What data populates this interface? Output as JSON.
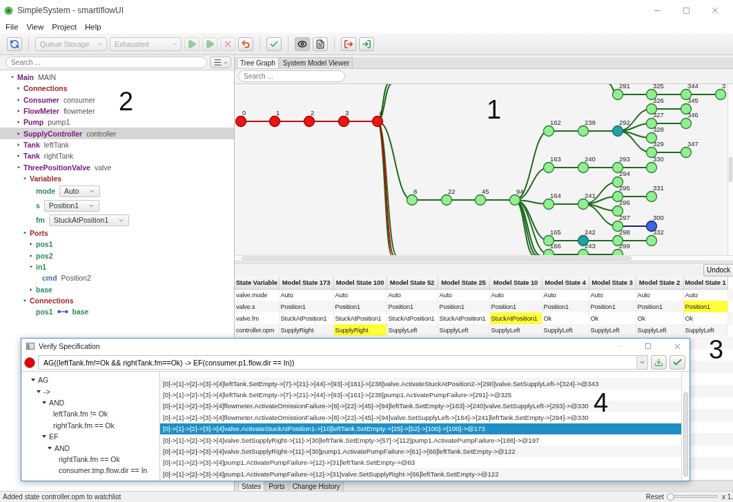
{
  "window": {
    "title": "SimpleSystem - smartIflowUI"
  },
  "menu": [
    "File",
    "View",
    "Project",
    "Help"
  ],
  "toolbar": {
    "groups": [
      [
        {
          "kind": "sync",
          "disabled": false,
          "pressed": false
        }
      ],
      [
        {
          "kind": "combo",
          "value": "Queue Storage",
          "disabled": true
        },
        {
          "kind": "combo",
          "value": "Exhausted",
          "disabled": true
        },
        {
          "kind": "play",
          "disabled": true,
          "pressed": false
        },
        {
          "kind": "fast-play",
          "disabled": true,
          "pressed": false
        },
        {
          "kind": "stop",
          "disabled": true,
          "pressed": false
        },
        {
          "kind": "undo",
          "disabled": false,
          "pressed": false
        }
      ],
      [
        {
          "kind": "verify",
          "disabled": false,
          "pressed": false
        }
      ],
      [
        {
          "kind": "eye",
          "disabled": false,
          "pressed": true
        },
        {
          "kind": "document",
          "disabled": false,
          "pressed": false
        }
      ],
      [
        {
          "kind": "exit",
          "disabled": false,
          "pressed": false
        },
        {
          "kind": "enter",
          "disabled": false,
          "pressed": false
        }
      ]
    ]
  },
  "model_tree": {
    "search": {
      "placeholder": "Search ..."
    },
    "items": [
      {
        "kind": "component",
        "type": "Main",
        "name": "MAIN",
        "expanded": true,
        "selected": false,
        "children": [
          {
            "kind": "group",
            "label": "Connections",
            "expanded": false,
            "selected": false
          },
          {
            "kind": "component",
            "type": "Consumer",
            "name": "consumer",
            "expanded": false,
            "selected": false
          },
          {
            "kind": "component",
            "type": "FlowMeter",
            "name": "flowmeter",
            "expanded": false,
            "selected": false
          },
          {
            "kind": "component",
            "type": "Pump",
            "name": "pump1",
            "expanded": false,
            "selected": false
          },
          {
            "kind": "component",
            "type": "SupplyController",
            "name": "controller",
            "expanded": false,
            "selected": true
          },
          {
            "kind": "component",
            "type": "Tank",
            "name": "leftTank",
            "expanded": false,
            "selected": false
          },
          {
            "kind": "component",
            "type": "Tank",
            "name": "rightTank",
            "expanded": false,
            "selected": false
          },
          {
            "kind": "component",
            "type": "ThreePositionValve",
            "name": "valve",
            "expanded": true,
            "selected": false,
            "children": [
              {
                "kind": "group",
                "label": "Variables",
                "expanded": true,
                "selected": false,
                "children": [
                  {
                    "kind": "variable",
                    "label": "mode",
                    "value": "Auto",
                    "selected": false
                  },
                  {
                    "kind": "variable",
                    "label": "s",
                    "value": "Position1",
                    "selected": false
                  },
                  {
                    "kind": "variable",
                    "label": "fm",
                    "value": "StuckAtPosition1",
                    "selected": false
                  }
                ]
              },
              {
                "kind": "group",
                "label": "Ports",
                "expanded": true,
                "selected": false,
                "children": [
                  {
                    "kind": "port",
                    "label": "pos1",
                    "expanded": false,
                    "selected": false
                  },
                  {
                    "kind": "port",
                    "label": "pos2",
                    "expanded": false,
                    "selected": false
                  },
                  {
                    "kind": "port",
                    "label": "in1",
                    "expanded": true,
                    "selected": false,
                    "children": [
                      {
                        "kind": "field",
                        "label": "cmd",
                        "value": "Position2",
                        "selected": false
                      }
                    ]
                  },
                  {
                    "kind": "port",
                    "label": "base",
                    "expanded": false,
                    "selected": false
                  }
                ]
              },
              {
                "kind": "group",
                "label": "Connections",
                "expanded": true,
                "selected": false,
                "children": [
                  {
                    "kind": "connection",
                    "from": "pos1",
                    "to": "base",
                    "selected": false
                  }
                ]
              }
            ]
          }
        ]
      }
    ]
  },
  "tabs": [
    {
      "label": "Tree Graph",
      "selected": true
    },
    {
      "label": "System Model Viewer",
      "selected": false
    }
  ],
  "graph": {
    "search": {
      "placeholder": "Search ..."
    },
    "trees": [
      {
        "label": "0",
        "kind": "path",
        "children": [
          {
            "label": "1",
            "kind": "path",
            "children": [
              {
                "label": "2",
                "kind": "path",
                "children": [
                  {
                    "label": "3",
                    "kind": "path",
                    "children": [
                      {
                        "label": "4",
                        "kind": "path",
                        "children": [
                          {
                            "label": "8",
                            "kind": "state",
                            "children": [
                              {
                                "label": "22",
                                "kind": "state",
                                "children": [
                                  {
                                    "label": "45",
                                    "kind": "state",
                                    "children": [
                                      {
                                        "label": "94",
                                        "kind": "state",
                                        "children": [
                                          {
                                            "label": "162",
                                            "kind": "state",
                                            "children": [
                                              {
                                                "label": "239",
                                                "kind": "state",
                                                "children": [
                                                  {
                                                    "label": "292",
                                                    "kind": "marked",
                                                    "children": [
                                                      {
                                                        "label": "326",
                                                        "kind": "state",
                                                        "children": [
                                                          {
                                                            "label": "345",
                                                            "kind": "state"
                                                          }
                                                        ]
                                                      },
                                                      {
                                                        "label": "327",
                                                        "kind": "state",
                                                        "children": [
                                                          {
                                                            "label": "346",
                                                            "kind": "state"
                                                          }
                                                        ]
                                                      },
                                                      {
                                                        "label": "328",
                                                        "kind": "state"
                                                      },
                                                      {
                                                        "label": "329",
                                                        "kind": "state",
                                                        "children": [
                                                          {
                                                            "label": "347",
                                                            "kind": "state"
                                                          }
                                                        ]
                                                      }
                                                    ]
                                                  }
                                                ]
                                              }
                                            ]
                                          },
                                          {
                                            "label": "163",
                                            "kind": "state",
                                            "children": [
                                              {
                                                "label": "240",
                                                "kind": "state",
                                                "children": [
                                                  {
                                                    "label": "293",
                                                    "kind": "state",
                                                    "children": [
                                                      {
                                                        "label": "330",
                                                        "kind": "state"
                                                      }
                                                    ]
                                                  }
                                                ]
                                              }
                                            ]
                                          },
                                          {
                                            "label": "164",
                                            "kind": "state",
                                            "children": [
                                              {
                                                "label": "241",
                                                "kind": "state",
                                                "children": [
                                                  {
                                                    "label": "294",
                                                    "kind": "state"
                                                  },
                                                  {
                                                    "label": "295",
                                                    "kind": "state",
                                                    "children": [
                                                      {
                                                        "label": "331",
                                                        "kind": "state"
                                                      }
                                                    ]
                                                  },
                                                  {
                                                    "label": "296",
                                                    "kind": "state"
                                                  },
                                                  {
                                                    "label": "297",
                                                    "kind": "state",
                                                    "children": [
                                                      {
                                                        "label": "300",
                                                        "kind": "current"
                                                      }
                                                    ]
                                                  }
                                                ]
                                              }
                                            ]
                                          },
                                          {
                                            "label": "165",
                                            "kind": "state",
                                            "children": [
                                              {
                                                "label": "242",
                                                "kind": "marked",
                                                "children": [
                                                  {
                                                    "label": "298",
                                                    "kind": "state",
                                                    "children": [
                                                      {
                                                        "label": "332",
                                                        "kind": "state"
                                                      }
                                                    ]
                                                  }
                                                ]
                                              }
                                            ]
                                          },
                                          {
                                            "label": "166",
                                            "kind": "state",
                                            "children": [
                                              {
                                                "label": "243",
                                                "kind": "state",
                                                "children": [
                                                  {
                                                    "label": "299",
                                                    "kind": "state"
                                                  }
                                                ]
                                              }
                                            ]
                                          }
                                        ]
                                      }
                                    ]
                                  }
                                ]
                              }
                            ]
                          }
                        ]
                      }
                    ]
                  }
                ]
              }
            ]
          }
        ]
      },
      {
        "label": "291",
        "kind": "state",
        "children": [
          {
            "label": "325",
            "kind": "state",
            "children": [
              {
                "label": "344",
                "kind": "state",
                "children": [
                  {
                    "label": "3",
                    "kind": "state"
                  }
                ]
              }
            ]
          }
        ]
      }
    ]
  },
  "undock_button": "Undock",
  "table": {
    "columns": [
      "State Variable",
      "Model State 173",
      "Model State 100",
      "Model State 52",
      "Model State 25",
      "Model State 10",
      "Model State 4",
      "Model State 3",
      "Model State 2",
      "Model State 1"
    ],
    "rows": [
      [
        {
          "text": "valve.mode",
          "highlighted": false
        },
        {
          "text": "Auto",
          "highlighted": false
        },
        {
          "text": "Auto",
          "highlighted": false
        },
        {
          "text": "Auto",
          "highlighted": false
        },
        {
          "text": "Auto",
          "highlighted": false
        },
        {
          "text": "Auto",
          "highlighted": false
        },
        {
          "text": "Auto",
          "highlighted": false
        },
        {
          "text": "Auto",
          "highlighted": false
        },
        {
          "text": "Auto",
          "highlighted": false
        },
        {
          "text": "Auto",
          "highlighted": false
        }
      ],
      [
        {
          "text": "valve.s",
          "highlighted": false
        },
        {
          "text": "Position1",
          "highlighted": false
        },
        {
          "text": "Position1",
          "highlighted": false
        },
        {
          "text": "Position1",
          "highlighted": false
        },
        {
          "text": "Position1",
          "highlighted": false
        },
        {
          "text": "Position1",
          "highlighted": false
        },
        {
          "text": "Position1",
          "highlighted": false
        },
        {
          "text": "Position1",
          "highlighted": false
        },
        {
          "text": "Position1",
          "highlighted": false
        },
        {
          "text": "Position1",
          "highlighted": true
        }
      ],
      [
        {
          "text": "valve.fm",
          "highlighted": false
        },
        {
          "text": "StuckAtPosition1",
          "highlighted": false
        },
        {
          "text": "StuckAtPosition1",
          "highlighted": false
        },
        {
          "text": "StuckAtPosition1",
          "highlighted": false
        },
        {
          "text": "StuckAtPosition1",
          "highlighted": false
        },
        {
          "text": "StuckAtPosition1",
          "highlighted": true
        },
        {
          "text": "Ok",
          "highlighted": false
        },
        {
          "text": "Ok",
          "highlighted": false
        },
        {
          "text": "Ok",
          "highlighted": false
        },
        {
          "text": "Ok",
          "highlighted": false
        }
      ],
      [
        {
          "text": "controller.opm",
          "highlighted": false
        },
        {
          "text": "SupplyRight",
          "highlighted": false
        },
        {
          "text": "SupplyRight",
          "highlighted": true
        },
        {
          "text": "SupplyLeft",
          "highlighted": false
        },
        {
          "text": "SupplyLeft",
          "highlighted": false
        },
        {
          "text": "SupplyLeft",
          "highlighted": false
        },
        {
          "text": "SupplyLeft",
          "highlighted": false
        },
        {
          "text": "SupplyLeft",
          "highlighted": false
        },
        {
          "text": "SupplyLeft",
          "highlighted": false
        },
        {
          "text": "SupplyLeft",
          "highlighted": false
        }
      ]
    ]
  },
  "bottom_tabs": [
    {
      "label": "States",
      "selected": true
    },
    {
      "label": "Ports",
      "selected": false
    },
    {
      "label": "Change History",
      "selected": false
    }
  ],
  "status_bar": {
    "message": "Added state controller.opm to watchlist",
    "zoom_reset": "Reset",
    "zoom": {
      "level": 0.04
    },
    "zoom_reading": "x 1."
  },
  "verify_dialog": {
    "title": "Verify Specification",
    "failed": true,
    "formula": "AG((leftTank.fm!=Ok && rightTank.fm==Ok) -> EF(consumer.p1.flow.dir == In))",
    "formula_tree": [
      {
        "label": "AG",
        "expanded": true,
        "children": [
          {
            "label": "->",
            "expanded": true,
            "children": [
              {
                "label": "AND",
                "expanded": true,
                "children": [
                  {
                    "label": "leftTank.fm != Ok"
                  },
                  {
                    "label": "rightTank.fm == Ok"
                  }
                ]
              },
              {
                "label": "EF",
                "expanded": true,
                "children": [
                  {
                    "label": "AND",
                    "expanded": true,
                    "children": [
                      {
                        "label": "rightTank.fm == Ok"
                      },
                      {
                        "label": "consumer.tmp.flow.dir == In"
                      }
                    ]
                  }
                ]
              }
            ]
          }
        ]
      }
    ],
    "traces": [
      {
        "text": "[0]->[1]->[2]->[3]->[4]leftTank.SetEmpty->[7]->[21]->[44]->[93]->[161]->[238]valve.ActivateStuckAtPosition2->[290]valve.SetSupplyLeft->[324]->@343",
        "selected": false
      },
      {
        "text": "[0]->[1]->[2]->[3]->[4]leftTank.SetEmpty->[7]->[21]->[44]->[93]->[161]->[238]pump1.ActivatePumpFailure->[291]->@325",
        "selected": false
      },
      {
        "text": "[0]->[1]->[2]->[3]->[4]flowmeter.ActivateOmissionFailure->[8]->[22]->[45]->[94]leftTank.SetEmpty->[163]->[240]valve.SetSupplyLeft->[293]->@330",
        "selected": false
      },
      {
        "text": "[0]->[1]->[2]->[3]->[4]flowmeter.ActivateOmissionFailure->[8]->[22]->[45]->[94]valve.SetSupplyLeft->[164]->[241]leftTank.SetEmpty->[294]->@330",
        "selected": false
      },
      {
        "text": "[0]->[1]->[2]->[3]->[4]valve.ActivateStuckAtPosition1->[10]leftTank.SetEmpty->[25]->[52]->[100]->[100]->@173",
        "selected": true
      },
      {
        "text": "[0]->[1]->[2]->[3]->[4]valve.SetSupplyRight->[11]->[30]leftTank.SetEmpty->[57]->[112]pump1.ActivatePumpFailure->[188]->@197",
        "selected": false
      },
      {
        "text": "[0]->[1]->[2]->[3]->[4]valve.SetSupplyRight->[11]->[30]pump1.ActivatePumpFailure->[61]->[66]leftTank.SetEmpty->@122",
        "selected": false
      },
      {
        "text": "[0]->[1]->[2]->[3]->[4]pump1.ActivatePumpFailure->[12]->[31]leftTank.SetEmpty->@63",
        "selected": false
      },
      {
        "text": "[0]->[1]->[2]->[3]->[4]pump1.ActivatePumpFailure->[12]->[31]valve.SetSupplyRight->[66]leftTank.SetEmpty->@122",
        "selected": false
      }
    ]
  },
  "annotations": [
    "1",
    "2",
    "3",
    "4"
  ]
}
